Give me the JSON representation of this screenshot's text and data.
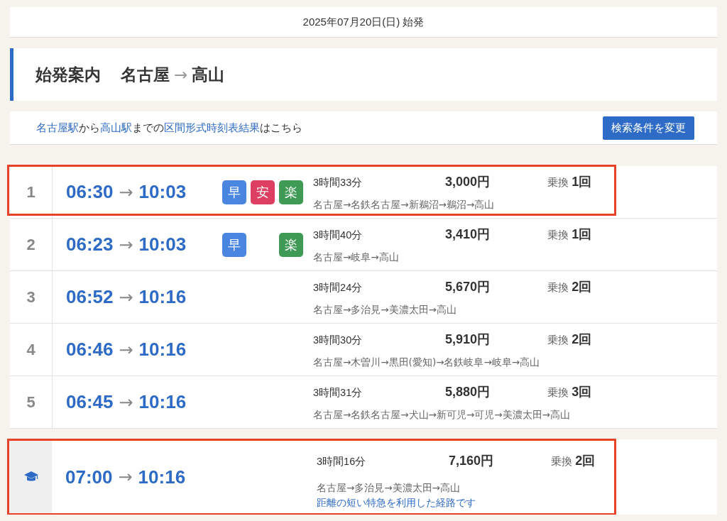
{
  "date_bar": {
    "text": "2025年07月20日(日) 始発"
  },
  "heading": {
    "label": "始発案内",
    "from": "名古屋",
    "arrow": "→",
    "to": "高山"
  },
  "link_bar": {
    "parts": [
      {
        "text": "名古屋駅",
        "link": true
      },
      {
        "text": "から",
        "link": false
      },
      {
        "text": "高山駅",
        "link": true
      },
      {
        "text": "までの",
        "link": false
      },
      {
        "text": "区間形式時刻表結果",
        "link": true
      },
      {
        "text": "はこちら",
        "link": false
      }
    ],
    "button": "検索条件を変更"
  },
  "routes": [
    {
      "number": "1",
      "depart": "06:30",
      "arrow": "→",
      "arrive": "10:03",
      "badges": [
        {
          "kind": "fast",
          "label": "早",
          "color": "#4a86e0"
        },
        {
          "kind": "cheap",
          "label": "安",
          "color": "#dd3f62"
        },
        {
          "kind": "easy",
          "label": "楽",
          "color": "#3e9a55"
        }
      ],
      "duration": "3時間33分",
      "fare": "3,000円",
      "transfer_label": "乗換",
      "transfers": "1回",
      "stations": "名古屋→名鉄名古屋→新鵜沼→鵜沼→高山",
      "highlighted": true
    },
    {
      "number": "2",
      "depart": "06:23",
      "arrow": "→",
      "arrive": "10:03",
      "badges": [
        {
          "kind": "fast",
          "label": "早",
          "color": "#4a86e0"
        },
        {
          "kind": "easy",
          "label": "楽",
          "color": "#3e9a55"
        }
      ],
      "duration": "3時間40分",
      "fare": "3,410円",
      "transfer_label": "乗換",
      "transfers": "1回",
      "stations": "名古屋→岐阜→高山",
      "highlighted": false
    },
    {
      "number": "3",
      "depart": "06:52",
      "arrow": "→",
      "arrive": "10:16",
      "duration": "3時間24分",
      "fare": "5,670円",
      "transfer_label": "乗換",
      "transfers": "2回",
      "stations": "名古屋→多治見→美濃太田→高山",
      "highlighted": false
    },
    {
      "number": "4",
      "depart": "06:46",
      "arrow": "→",
      "arrive": "10:16",
      "duration": "3時間30分",
      "fare": "5,910円",
      "transfer_label": "乗換",
      "transfers": "2回",
      "stations": "名古屋→木曽川→黒田(愛知)→名鉄岐阜→岐阜→高山",
      "highlighted": false
    },
    {
      "number": "5",
      "depart": "06:45",
      "arrow": "→",
      "arrive": "10:16",
      "duration": "3時間31分",
      "fare": "5,880円",
      "transfer_label": "乗換",
      "transfers": "3回",
      "stations": "名古屋→名鉄名古屋→犬山→新可児→可児→美濃太田→高山",
      "highlighted": false
    }
  ],
  "special_route": {
    "depart": "07:00",
    "arrow": "→",
    "arrive": "10:16",
    "duration": "3時間16分",
    "fare": "7,160円",
    "transfer_label": "乗換",
    "transfers": "2回",
    "stations": "名古屋→多治見→美濃太田→高山",
    "note": "距離の短い特急を利用した経路です",
    "highlighted": true
  }
}
